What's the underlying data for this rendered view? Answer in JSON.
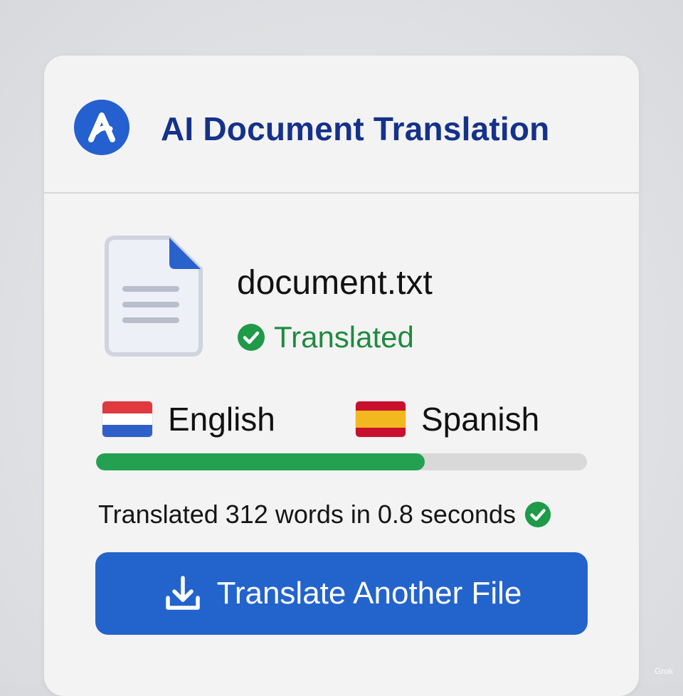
{
  "app": {
    "title": "AI Document Translation",
    "logo_icon": "ai-a-logo-icon",
    "brand_color": "#2460cf",
    "title_color": "#15328a"
  },
  "file": {
    "name": "document.txt",
    "icon": "document-icon",
    "status": "Translated",
    "status_icon": "check-circle-icon",
    "status_color": "#1f8a3e"
  },
  "languages": {
    "source": {
      "name": "English",
      "flag": "netherlands-flag-icon"
    },
    "target": {
      "name": "Spanish",
      "flag": "spain-flag-icon"
    }
  },
  "progress": {
    "value": 0.67,
    "fill_color": "#24a150",
    "track_color": "#d9d9d9"
  },
  "summary": {
    "text": "Translated 312 words in 0.8 seconds",
    "icon": "check-circle-icon"
  },
  "action": {
    "label": "Translate Another File",
    "icon": "download-icon",
    "color": "#2363cc"
  },
  "watermark": "Grok"
}
